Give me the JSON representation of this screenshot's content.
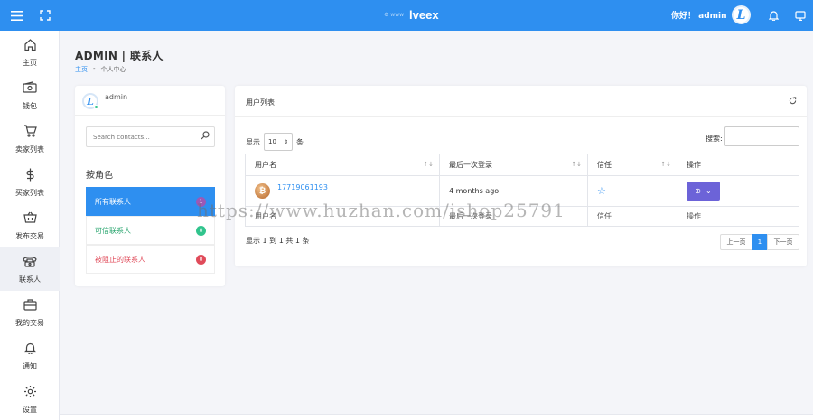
{
  "topbar": {
    "brand_mark": "⚙ www",
    "brand_name": "lveex",
    "greeting": "你好！ admin",
    "avatar_letter": "L",
    "icons": [
      "menu-icon",
      "fullscreen-icon",
      "bell-icon",
      "monitor-icon"
    ]
  },
  "sidebar": {
    "items": [
      {
        "label": "主页",
        "icon": "home-icon"
      },
      {
        "label": "钱包",
        "icon": "wallet-icon"
      },
      {
        "label": "卖家列表",
        "icon": "cart-icon"
      },
      {
        "label": "买家列表",
        "icon": "dollar-icon"
      },
      {
        "label": "发布交易",
        "icon": "basket-icon"
      },
      {
        "label": "联系人",
        "icon": "phone-icon"
      },
      {
        "label": "我的交易",
        "icon": "briefcase-icon"
      },
      {
        "label": "通知",
        "icon": "bell-icon"
      },
      {
        "label": "设置",
        "icon": "gear-icon"
      }
    ],
    "active_index": 5
  },
  "page": {
    "title": "ADMIN | 联系人",
    "breadcrumb": {
      "home": "主页",
      "separator": "-",
      "current": "个人中心"
    }
  },
  "contacts_panel": {
    "username": "admin",
    "avatar_letter": "L",
    "search_placeholder": "Search contacts...",
    "role_title": "按角色",
    "roles": [
      {
        "label": "所有联系人",
        "count": "1",
        "badge_color": "#9b59b6"
      },
      {
        "label": "可信联系人",
        "count": "0",
        "badge_color": "#31c48d"
      },
      {
        "label": "被阻止的联系人",
        "count": "0",
        "badge_color": "#e04b5a"
      }
    ]
  },
  "users_panel": {
    "title": "用户列表",
    "length_prefix": "显示",
    "length_value": "10",
    "length_suffix": "条",
    "search_label": "搜索:",
    "columns": [
      "用户名",
      "最后一次登录",
      "信任",
      "操作"
    ],
    "rows": [
      {
        "username": "17719061193",
        "last_login": "4 months ago",
        "trusted": false
      }
    ],
    "info": "显示 1 到 1 共 1 条",
    "pagination": {
      "prev": "上一页",
      "current": "1",
      "next": "下一页"
    }
  },
  "watermark": "https://www.huzhan.com/ishop25791",
  "colors": {
    "primary": "#2e8ff0",
    "action": "#6c63d8",
    "success": "#31c48d",
    "danger": "#e04b5a"
  }
}
